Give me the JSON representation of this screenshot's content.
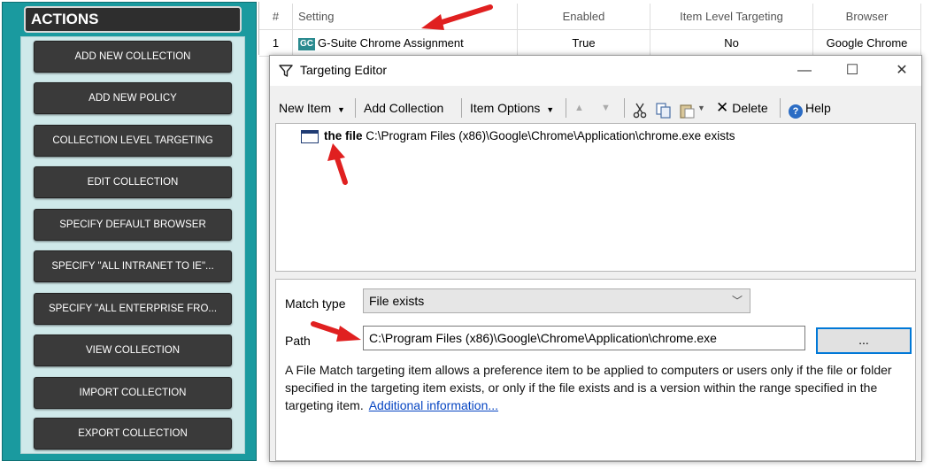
{
  "actions": {
    "header": "ACTIONS",
    "buttons": [
      "ADD NEW COLLECTION",
      "ADD NEW POLICY",
      "COLLECTION LEVEL TARGETING",
      "EDIT COLLECTION",
      "SPECIFY DEFAULT BROWSER",
      "SPECIFY \"ALL INTRANET TO IE\"...",
      "SPECIFY \"ALL ENTERPRISE FRO...",
      "VIEW COLLECTION",
      "IMPORT COLLECTION",
      "EXPORT COLLECTION"
    ]
  },
  "grid": {
    "headers": {
      "num": "#",
      "setting": "Setting",
      "enabled": "Enabled",
      "ilt": "Item Level Targeting",
      "browser": "Browser"
    },
    "rows": [
      {
        "num": "1",
        "badge": "GC",
        "setting": "G-Suite Chrome Assignment",
        "enabled": "True",
        "ilt": "No",
        "browser": "Google Chrome"
      }
    ]
  },
  "editor": {
    "title": "Targeting Editor",
    "window_buttons": {
      "minimize": "—",
      "maximize": "☐",
      "close": "✕"
    },
    "toolbar": {
      "new_item": "New Item",
      "add_collection": "Add Collection",
      "item_options": "Item Options",
      "delete": "Delete",
      "help": "Help"
    },
    "items": [
      {
        "prefix": "the file",
        "text": "C:\\Program Files (x86)\\Google\\Chrome\\Application\\chrome.exe exists"
      }
    ],
    "properties": {
      "match_type_label": "Match type",
      "match_type_value": "File exists",
      "path_label": "Path",
      "path_value": "C:\\Program Files (x86)\\Google\\Chrome\\Application\\chrome.exe",
      "browse_label": "...",
      "description": "A File Match targeting item allows a preference item to be applied to computers or users only if the file or folder specified in the targeting item exists, or only if the file exists and is a version within the range specified in the targeting item.",
      "link": "Additional information..."
    }
  },
  "colors": {
    "panel_teal": "#1a9a9f",
    "button_dark": "#3a3a3a",
    "arrow_red": "#e02020",
    "link_blue": "#0645c2"
  }
}
